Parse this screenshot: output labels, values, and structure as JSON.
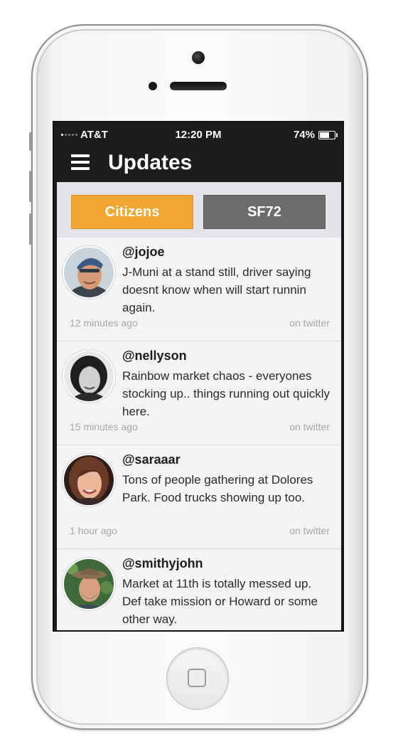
{
  "status_bar": {
    "carrier": "AT&T",
    "time": "12:20 PM",
    "battery": "74%",
    "battery_level": 0.74
  },
  "nav": {
    "title": "Updates",
    "menu_icon": "hamburger-menu-icon"
  },
  "tabs": [
    {
      "label": "Citizens",
      "active": true,
      "color": "#f0a630"
    },
    {
      "label": "SF72",
      "active": false,
      "color": "#6b6b6b"
    }
  ],
  "feed": [
    {
      "handle": "@jojoe",
      "message": "J-Muni at a stand still, driver saying doesnt know when will start runnin again.",
      "time": "12 minutes ago",
      "source": "on twitter"
    },
    {
      "handle": "@nellyson",
      "message": "Rainbow market chaos - everyones stocking up.. things running out quickly here.",
      "time": "15 minutes ago",
      "source": "on twitter"
    },
    {
      "handle": "@saraaar",
      "message": "Tons of people gathering at Dolores Park. Food trucks showing up too.",
      "time": "1 hour ago",
      "source": "on twitter"
    },
    {
      "handle": "@smithyjohn",
      "message": "Market at 11th is totally messed up. Def take mission or Howard or some other way.",
      "time": "",
      "source": ""
    }
  ],
  "colors": {
    "accent": "#f0a630",
    "inactive_tab": "#6b6b6b",
    "nav_background": "#1c1c1c",
    "card_background": "#f4f3f6"
  }
}
